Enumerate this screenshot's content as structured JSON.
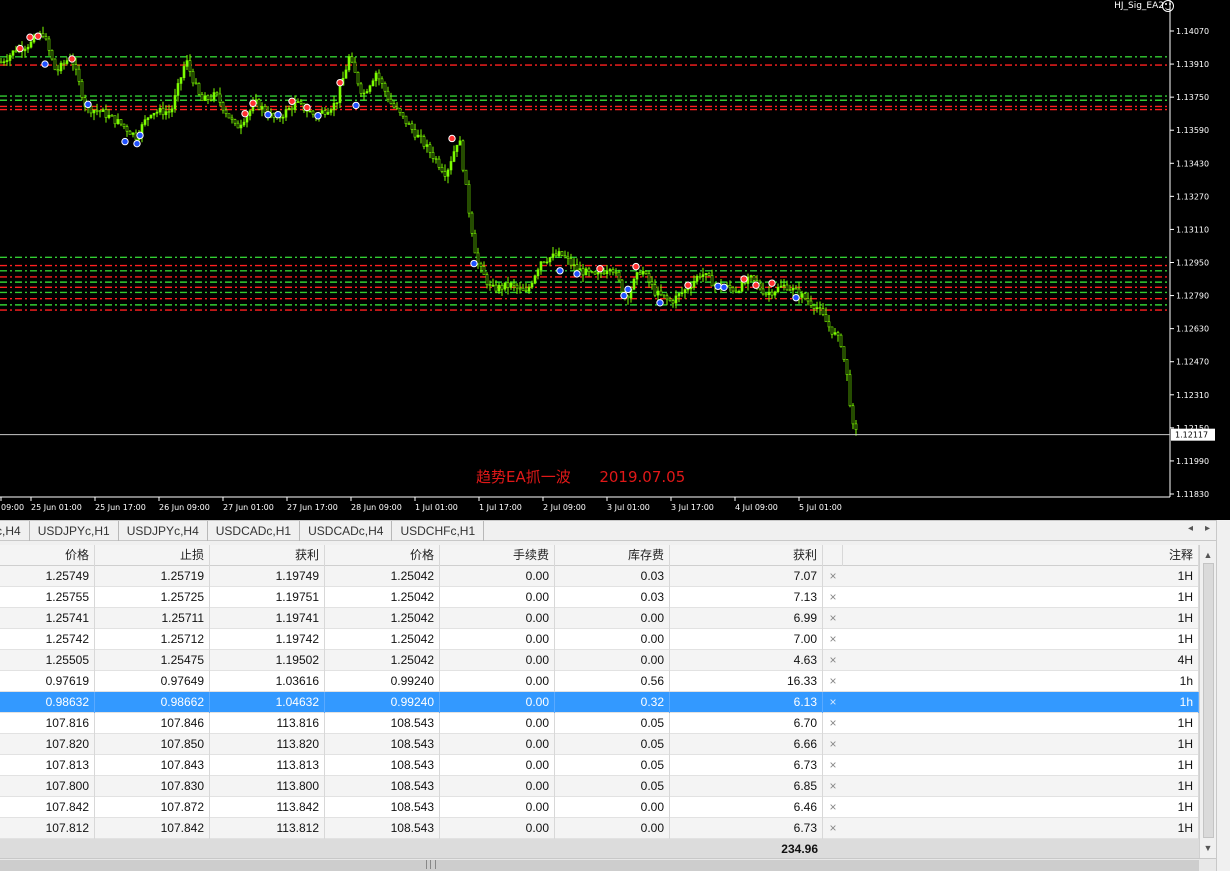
{
  "chart": {
    "ea_name": "HJ_Sig_EA2",
    "caption": "趋势EA抓一波      2019.07.05",
    "price_labels": [
      "1.14070",
      "1.13910",
      "1.13750",
      "1.13590",
      "1.13430",
      "1.13270",
      "1.13110",
      "1.12950",
      "1.12790",
      "1.12630",
      "1.12470",
      "1.12310",
      "1.12150",
      "1.11990",
      "1.11830"
    ],
    "current_price": "1.12117",
    "time_labels": [
      "09:00",
      "25 Jun 01:00",
      "25 Jun 17:00",
      "26 Jun 09:00",
      "27 Jun 01:00",
      "27 Jun 17:00",
      "28 Jun 09:00",
      "1 Jul 01:00",
      "1 Jul 17:00",
      "2 Jul 09:00",
      "3 Jul 01:00",
      "3 Jul 17:00",
      "4 Jul 09:00",
      "5 Jul 01:00"
    ],
    "colors": {
      "background": "#000000",
      "candle": "#7CFC00",
      "support_line": "#32CD32",
      "resistance_line": "#FF2020"
    }
  },
  "tabs": [
    "c,H4",
    "USDJPYc,H1",
    "USDJPYc,H4",
    "USDCADc,H1",
    "USDCADc,H4",
    "USDCHFc,H1"
  ],
  "table": {
    "headers": [
      "价格",
      "止损",
      "获利",
      "价格",
      "手续费",
      "库存费",
      "获利",
      "",
      "注释"
    ],
    "rows": [
      [
        "1.25749",
        "1.25719",
        "1.19749",
        "1.25042",
        "0.00",
        "0.03",
        "7.07",
        "×",
        "1H"
      ],
      [
        "1.25755",
        "1.25725",
        "1.19751",
        "1.25042",
        "0.00",
        "0.03",
        "7.13",
        "×",
        "1H"
      ],
      [
        "1.25741",
        "1.25711",
        "1.19741",
        "1.25042",
        "0.00",
        "0.00",
        "6.99",
        "×",
        "1H"
      ],
      [
        "1.25742",
        "1.25712",
        "1.19742",
        "1.25042",
        "0.00",
        "0.00",
        "7.00",
        "×",
        "1H"
      ],
      [
        "1.25505",
        "1.25475",
        "1.19502",
        "1.25042",
        "0.00",
        "0.00",
        "4.63",
        "×",
        "4H"
      ],
      [
        "0.97619",
        "0.97649",
        "1.03616",
        "0.99240",
        "0.00",
        "0.56",
        "16.33",
        "×",
        "1h"
      ],
      [
        "0.98632",
        "0.98662",
        "1.04632",
        "0.99240",
        "0.00",
        "0.32",
        "6.13",
        "×",
        "1h"
      ],
      [
        "107.816",
        "107.846",
        "113.816",
        "108.543",
        "0.00",
        "0.05",
        "6.70",
        "×",
        "1H"
      ],
      [
        "107.820",
        "107.850",
        "113.820",
        "108.543",
        "0.00",
        "0.05",
        "6.66",
        "×",
        "1H"
      ],
      [
        "107.813",
        "107.843",
        "113.813",
        "108.543",
        "0.00",
        "0.05",
        "6.73",
        "×",
        "1H"
      ],
      [
        "107.800",
        "107.830",
        "113.800",
        "108.543",
        "0.00",
        "0.05",
        "6.85",
        "×",
        "1H"
      ],
      [
        "107.842",
        "107.872",
        "113.842",
        "108.543",
        "0.00",
        "0.00",
        "6.46",
        "×",
        "1H"
      ],
      [
        "107.812",
        "107.842",
        "113.812",
        "108.543",
        "0.00",
        "0.00",
        "6.73",
        "×",
        "1H"
      ]
    ],
    "selected_row": 6,
    "total_profit": "234.96"
  }
}
